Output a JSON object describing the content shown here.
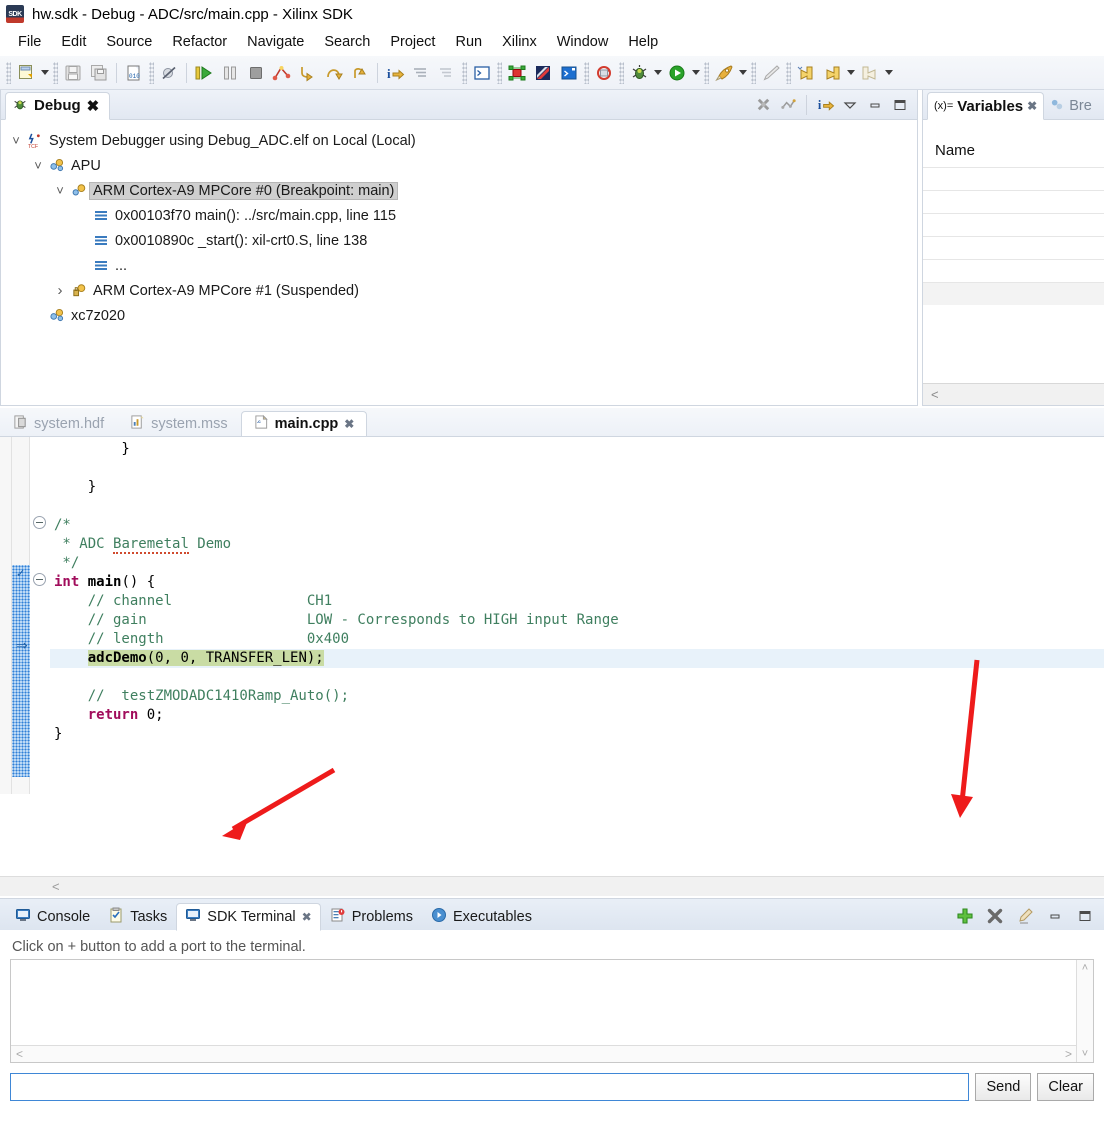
{
  "window": {
    "title": "hw.sdk - Debug - ADC/src/main.cpp - Xilinx SDK",
    "logo_text": "SDK"
  },
  "menubar": {
    "items": [
      "File",
      "Edit",
      "Source",
      "Refactor",
      "Navigate",
      "Search",
      "Project",
      "Run",
      "Xilinx",
      "Window",
      "Help"
    ]
  },
  "toolbar": {
    "icons": [
      "new-icon",
      "save-icon",
      "save-all-icon",
      "build-icon",
      "skip-breakpoints-icon",
      "resume-icon",
      "suspend-icon",
      "terminate-icon",
      "disconnect-icon",
      "step-into-icon",
      "step-over-icon",
      "step-return-icon",
      "instruction-stepping-icon",
      "next-edit-icon",
      "previous-edit-icon",
      "console-icon",
      "program-fpga-icon",
      "hardware-icon",
      "xsct-icon",
      "refresh-icon",
      "debug-icon",
      "run-icon",
      "launch-icon",
      "pencil-icon",
      "back-history-icon",
      "back-icon",
      "forward-icon"
    ]
  },
  "debug_view": {
    "tab_label": "Debug",
    "tab_icon": "bug-icon",
    "toolbar_icons": [
      "remove-all-terminated-icon",
      "relaunch-icon",
      "view-menu-icon",
      "minimize-icon",
      "maximize-icon"
    ],
    "tree": [
      {
        "depth": 0,
        "twist": "expanded",
        "icon": "tcf-icon",
        "label": "System Debugger using Debug_ADC.elf on Local (Local)",
        "selected": false
      },
      {
        "depth": 1,
        "twist": "expanded",
        "icon": "cpu-cluster-icon",
        "label": "APU",
        "selected": false
      },
      {
        "depth": 2,
        "twist": "expanded",
        "icon": "thread-icon",
        "label": "ARM Cortex-A9 MPCore #0 (Breakpoint: main)",
        "selected": true
      },
      {
        "depth": 3,
        "twist": "none",
        "icon": "stack-frame-icon",
        "label": "0x00103f70 main(): ../src/main.cpp, line 115",
        "selected": false
      },
      {
        "depth": 3,
        "twist": "none",
        "icon": "stack-frame-icon",
        "label": "0x0010890c _start(): xil-crt0.S, line 138",
        "selected": false
      },
      {
        "depth": 3,
        "twist": "none",
        "icon": "stack-frame-icon",
        "label": "...",
        "selected": false
      },
      {
        "depth": 2,
        "twist": "collapsed",
        "icon": "thread-suspended-icon",
        "label": "ARM Cortex-A9 MPCore #1 (Suspended)",
        "selected": false
      },
      {
        "depth": 1,
        "twist": "none",
        "icon": "cpu-cluster-icon",
        "label": "xc7z020",
        "selected": false
      }
    ]
  },
  "variables_view": {
    "tab_label": "Variables",
    "tab_icon": "variables-icon",
    "tab_prefix": "(x)=",
    "second_tab_label": "Bre",
    "second_tab_icon": "breakpoints-icon",
    "column_header": "Name",
    "row_count": 6,
    "scroll_left_glyph": "<"
  },
  "editor": {
    "tabs": [
      {
        "label": "system.hdf",
        "icon": "hdf-file-icon",
        "active": false,
        "closable": false
      },
      {
        "label": "system.mss",
        "icon": "mss-file-icon",
        "active": false,
        "closable": false
      },
      {
        "label": "main.cpp",
        "icon": "cpp-file-icon",
        "active": true,
        "closable": true
      }
    ],
    "lines": [
      {
        "text": "        }",
        "type": "plain"
      },
      {
        "text": "",
        "type": "plain"
      },
      {
        "text": "    }",
        "type": "plain"
      },
      {
        "text": "",
        "type": "plain"
      },
      {
        "text": "/*",
        "type": "comment",
        "fold": true
      },
      {
        "text": " * ADC Baremetal Demo",
        "type": "comment",
        "squiggle": "Baremetal"
      },
      {
        "text": " */",
        "type": "comment"
      },
      {
        "text": "int main() {",
        "type": "signature",
        "fold": true
      },
      {
        "text": "    // channel                CH1",
        "type": "comment"
      },
      {
        "text": "    // gain                   LOW - Corresponds to HIGH input Range",
        "type": "comment"
      },
      {
        "text": "    // length                 0x400",
        "type": "comment"
      },
      {
        "text": "    adcDemo(0, 0, TRANSFER_LEN);",
        "type": "highlighted-statement"
      },
      {
        "text": "",
        "type": "plain"
      },
      {
        "text": "    //  testZMODADC1410Ramp_Auto();",
        "type": "comment"
      },
      {
        "text": "    return 0;",
        "type": "return"
      },
      {
        "text": "}",
        "type": "plain"
      }
    ],
    "hscroll_left_glyph": "<"
  },
  "console_view": {
    "tabs": [
      {
        "label": "Console",
        "icon": "console-icon",
        "active": false,
        "closable": false
      },
      {
        "label": "Tasks",
        "icon": "tasks-icon",
        "active": false,
        "closable": false
      },
      {
        "label": "SDK Terminal",
        "icon": "terminal-icon",
        "active": true,
        "closable": true
      },
      {
        "label": "Problems",
        "icon": "problems-icon",
        "active": false,
        "closable": false
      },
      {
        "label": "Executables",
        "icon": "executables-icon",
        "active": false,
        "closable": false
      }
    ],
    "toolbar_icons": [
      "add-port-icon",
      "disconnect-port-icon",
      "clear-terminal-icon",
      "minimize-icon",
      "maximize-icon"
    ],
    "hint_text": "Click on + button to add a port to the terminal.",
    "terminal_content": "",
    "input_value": "",
    "send_label": "Send",
    "clear_label": "Clear",
    "scroll_up_glyph": "˄",
    "scroll_down_glyph": "˅",
    "scroll_left_glyph": "<",
    "scroll_right_glyph": ">"
  },
  "annotations": {
    "arrow_color": "#ee1b1b",
    "arrows": [
      {
        "name": "arrow-to-sdk-terminal-tab",
        "target": "SDK Terminal tab"
      },
      {
        "name": "arrow-to-add-port-button",
        "target": "add port (+) button"
      }
    ]
  }
}
